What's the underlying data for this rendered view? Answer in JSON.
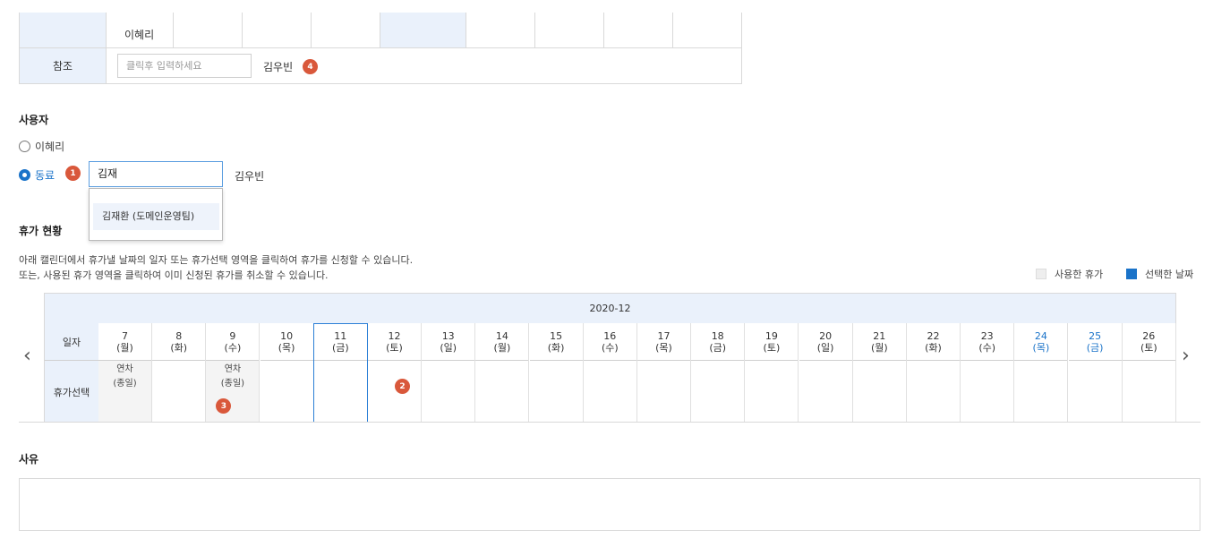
{
  "approval": {
    "approver_name": "이혜리",
    "ref_label": "참조",
    "ref_placeholder": "클릭후 입력하세요",
    "ref_name": "김우빈",
    "ref_badge": "4"
  },
  "user_section": {
    "title": "사용자",
    "option_self": "이혜리",
    "option_coworker": "동료",
    "coworker_badge": "1",
    "coworker_input_value": "김재",
    "coworker_name": "김우빈",
    "suggestion": "김재환 (도메인운영팀)"
  },
  "leave_status": {
    "title": "휴가 현황",
    "desc_line1": "아래 캘린더에서 휴가낼 날짜의 일자 또는 휴가선택 영역을 클릭하여 휴가를 신청할 수 있습니다.",
    "desc_line2": "또는, 사용된 휴가 영역을 클릭하여 이미 신청된 휴가를 취소할 수 있습니다.",
    "legend_used": "사용한 휴가",
    "legend_selected": "선택한 날짜",
    "legend_used_color": "#eeeeee",
    "legend_selected_color": "#1a73c9"
  },
  "calendar": {
    "month": "2020-12",
    "row_date_label": "일자",
    "row_select_label": "휴가선택",
    "prev_icon": "chevron-left-icon",
    "next_icon": "chevron-right-icon",
    "days": [
      {
        "d": "7",
        "w": "(월)",
        "entry1": "연차",
        "entry2": "(종일)",
        "used": true
      },
      {
        "d": "8",
        "w": "(화)"
      },
      {
        "d": "9",
        "w": "(수)",
        "entry1": "연차",
        "entry2": "(종일)",
        "used": true,
        "badge": "3"
      },
      {
        "d": "10",
        "w": "(목)"
      },
      {
        "d": "11",
        "w": "(금)",
        "selected": true
      },
      {
        "d": "12",
        "w": "(토)",
        "badge": "2"
      },
      {
        "d": "13",
        "w": "(일)"
      },
      {
        "d": "14",
        "w": "(월)"
      },
      {
        "d": "15",
        "w": "(화)"
      },
      {
        "d": "16",
        "w": "(수)"
      },
      {
        "d": "17",
        "w": "(목)"
      },
      {
        "d": "18",
        "w": "(금)"
      },
      {
        "d": "19",
        "w": "(토)"
      },
      {
        "d": "20",
        "w": "(일)"
      },
      {
        "d": "21",
        "w": "(월)"
      },
      {
        "d": "22",
        "w": "(화)"
      },
      {
        "d": "23",
        "w": "(수)"
      },
      {
        "d": "24",
        "w": "(목)",
        "holiday": true
      },
      {
        "d": "25",
        "w": "(금)",
        "holiday": true
      },
      {
        "d": "26",
        "w": "(토)"
      }
    ]
  },
  "reason": {
    "title": "사유"
  }
}
